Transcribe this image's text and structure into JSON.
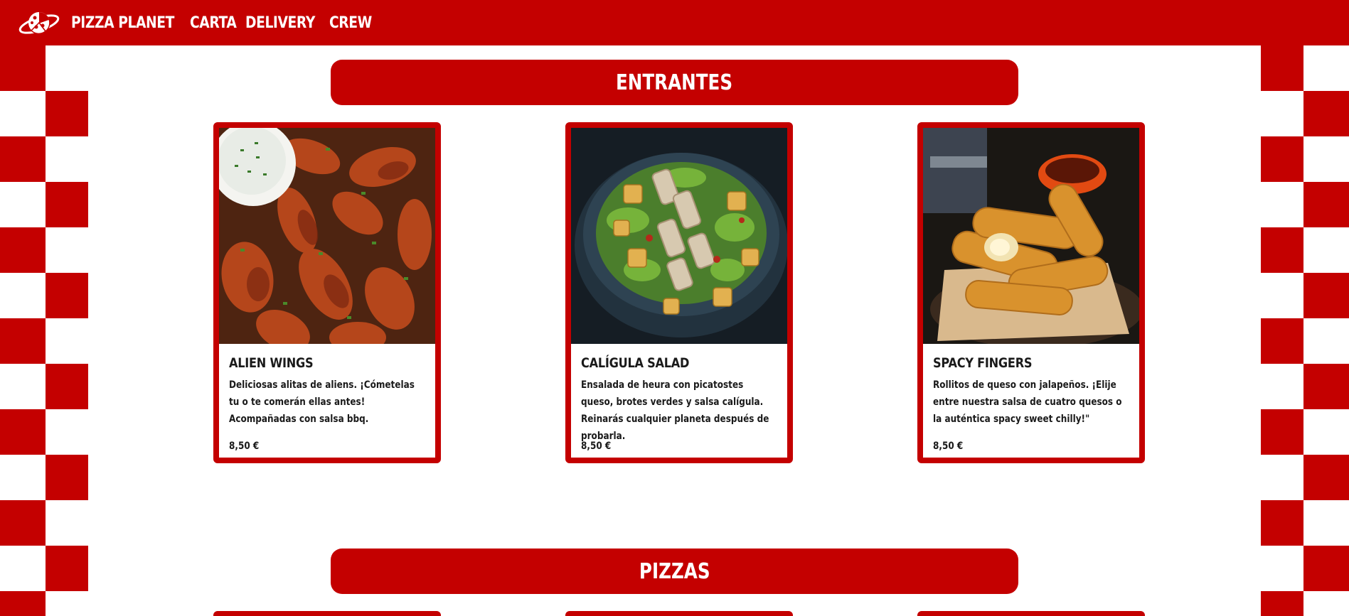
{
  "header": {
    "logo_icon": "pizza-planet-logo",
    "nav": [
      {
        "label": "PIZZA PLANET"
      },
      {
        "label": "CARTA"
      },
      {
        "label": "DELIVERY"
      },
      {
        "label": "CREW"
      }
    ]
  },
  "sections": [
    {
      "title": "ENTRANTES",
      "items": [
        {
          "name": "ALIEN WINGS",
          "description": "Deliciosas alitas de aliens. ¡Cómetelas tu o te comerán ellas antes! Acompañadas con salsa bbq.",
          "price": "8,50 €"
        },
        {
          "name": "CALÍGULA SALAD",
          "description": "Ensalada de heura con picatostes queso, brotes verdes y salsa calígula. Reinarás cualquier planeta después de probarla.",
          "price": "8,50 €"
        },
        {
          "name": "SPACY FINGERS",
          "description": "Rollitos de queso con jalapeños. ¡Elije entre nuestra salsa de cuatro quesos o la auténtica spacy sweet chilly!\"",
          "price": "8,50 €"
        }
      ]
    },
    {
      "title": "PIZZAS",
      "items": []
    }
  ],
  "colors": {
    "brand_red": "#c40000",
    "text": "#1a1a1a"
  }
}
